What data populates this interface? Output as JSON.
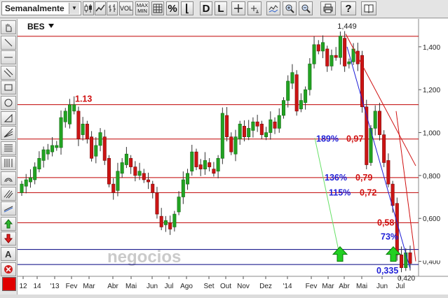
{
  "toolbar": {
    "period_label": "Semanalmente",
    "buttons": [
      {
        "name": "toolbar-candles-button",
        "icon": "candlestick-icon",
        "label": ""
      },
      {
        "name": "toolbar-line-type-button",
        "icon": "line-chart-icon",
        "label": ""
      },
      {
        "name": "toolbar-bars-button",
        "icon": "ohlc-bars-icon",
        "label": ""
      },
      {
        "name": "toolbar-volume-button",
        "icon": "",
        "label": "VOL"
      },
      {
        "name": "toolbar-maxmin-button",
        "icon": "",
        "label": "MAX MIN"
      },
      {
        "name": "toolbar-grid-button",
        "icon": "grid-icon",
        "label": ""
      },
      {
        "name": "toolbar-percent-button",
        "icon": "",
        "label": "%"
      },
      {
        "name": "toolbar-log-button",
        "icon": "",
        "label": "⌊"
      },
      {
        "name": "toolbar-daily-button",
        "icon": "",
        "label": "D"
      },
      {
        "name": "toolbar-linear-button",
        "icon": "",
        "label": "L"
      },
      {
        "name": "toolbar-crosshair-button",
        "icon": "crosshair-icon",
        "label": ""
      },
      {
        "name": "toolbar-cursor-button",
        "icon": "cursor-icon",
        "label": ""
      },
      {
        "name": "toolbar-indicator-button",
        "icon": "indicator-icon",
        "label": ""
      },
      {
        "name": "toolbar-zoom-in-button",
        "icon": "zoom-in-icon",
        "label": ""
      },
      {
        "name": "toolbar-zoom-out-button",
        "icon": "zoom-out-icon",
        "label": ""
      },
      {
        "name": "toolbar-print-button",
        "icon": "print-icon",
        "label": ""
      },
      {
        "name": "toolbar-help-button",
        "icon": "",
        "label": "?"
      },
      {
        "name": "toolbar-book-button",
        "icon": "book-icon",
        "label": ""
      }
    ]
  },
  "sidebar": {
    "tools": [
      {
        "name": "hand-tool",
        "icon": "hand-icon"
      },
      {
        "name": "line-tool",
        "icon": "diagonal-line-icon"
      },
      {
        "name": "hline-tool",
        "icon": "horizontal-line-icon"
      },
      {
        "name": "channel-tool",
        "icon": "parallel-channel-icon"
      },
      {
        "name": "rectangle-tool",
        "icon": "rectangle-icon"
      },
      {
        "name": "circle-tool",
        "icon": "circle-icon"
      },
      {
        "name": "triangle-tool",
        "icon": "triangle-icon"
      },
      {
        "name": "fan-tool",
        "icon": "fan-lines-icon"
      },
      {
        "name": "fibonacci-tool",
        "icon": "fibonacci-icon"
      },
      {
        "name": "fibonacci-time-tool",
        "icon": "vertical-lines-icon"
      },
      {
        "name": "arc-tool",
        "icon": "arc-icon"
      },
      {
        "name": "pitchfork-tool",
        "icon": "pitchfork-icon"
      },
      {
        "name": "regression-tool",
        "icon": "regression-icon"
      },
      {
        "name": "buy-arrow-tool",
        "icon": "up-arrow-icon"
      },
      {
        "name": "sell-arrow-tool",
        "icon": "down-arrow-icon"
      },
      {
        "name": "text-tool",
        "icon": "text-icon"
      },
      {
        "name": "delete-tool",
        "icon": "delete-icon"
      }
    ],
    "color_swatch": "#e00000"
  },
  "chart_data": {
    "type": "candlestick",
    "symbol": "BES",
    "watermark": "negocios",
    "x_tick_labels": [
      "12",
      "14",
      "'13",
      "Fev",
      "Mar",
      "Abr",
      "Mai",
      "Jun",
      "Jul",
      "Ago",
      "Set",
      "Out",
      "Nov",
      "Dez",
      "'14",
      "Fev",
      "Mar",
      "Abr",
      "Mai",
      "Jun",
      "Jul"
    ],
    "y_tick_labels": [
      "0,400",
      "0,600",
      "0,800",
      "1,000",
      "1,200",
      "1,400"
    ],
    "y_range": [
      0.33,
      1.53
    ],
    "candles": [
      [
        0.72,
        0.76
      ],
      [
        0.75,
        0.78
      ],
      [
        0.77,
        0.79
      ],
      [
        0.78,
        0.84
      ],
      [
        0.83,
        0.88
      ],
      [
        0.87,
        0.92
      ],
      [
        0.9,
        0.92
      ],
      [
        0.91,
        0.94
      ],
      [
        0.93,
        0.94
      ],
      [
        0.93,
        1.07
      ],
      [
        1.05,
        1.1
      ],
      [
        1.04,
        1.13
      ],
      [
        1.1,
        1.13
      ],
      [
        1.1,
        0.97
      ],
      [
        0.99,
        1.04
      ],
      [
        1.04,
        0.97
      ],
      [
        0.98,
        0.88
      ],
      [
        0.89,
        0.94
      ],
      [
        0.94,
        1.0
      ],
      [
        0.98,
        0.87
      ],
      [
        0.88,
        0.76
      ],
      [
        0.76,
        0.72
      ],
      [
        0.73,
        0.82
      ],
      [
        0.81,
        0.86
      ],
      [
        0.85,
        0.9
      ],
      [
        0.88,
        0.84
      ],
      [
        0.84,
        0.8
      ],
      [
        0.8,
        0.82
      ],
      [
        0.81,
        0.78
      ],
      [
        0.78,
        0.77
      ],
      [
        0.76,
        0.72
      ],
      [
        0.72,
        0.62
      ],
      [
        0.61,
        0.56
      ],
      [
        0.57,
        0.59
      ],
      [
        0.58,
        0.55
      ],
      [
        0.56,
        0.62
      ],
      [
        0.63,
        0.7
      ],
      [
        0.7,
        0.78
      ],
      [
        0.76,
        0.81
      ],
      [
        0.82,
        0.91
      ],
      [
        0.91,
        0.84
      ],
      [
        0.85,
        0.83
      ],
      [
        0.83,
        0.87
      ],
      [
        0.86,
        0.84
      ],
      [
        0.83,
        0.81
      ],
      [
        0.82,
        0.88
      ],
      [
        0.88,
        1.09
      ],
      [
        1.08,
        0.98
      ],
      [
        0.98,
        0.91
      ],
      [
        0.9,
        0.98
      ],
      [
        0.97,
        1.04
      ],
      [
        1.03,
        0.98
      ],
      [
        0.98,
        1.02
      ],
      [
        1.01,
        1.05
      ],
      [
        1.05,
        1.03
      ],
      [
        1.04,
        0.99
      ],
      [
        0.98,
        1.0
      ],
      [
        1.0,
        1.06
      ],
      [
        1.05,
        1.02
      ],
      [
        1.02,
        1.08
      ],
      [
        1.08,
        1.15
      ],
      [
        1.15,
        1.24
      ],
      [
        1.23,
        1.28
      ],
      [
        1.27,
        1.1
      ],
      [
        1.11,
        1.15
      ],
      [
        1.14,
        1.2
      ],
      [
        1.2,
        1.32
      ],
      [
        1.32,
        1.41
      ],
      [
        1.41,
        1.38
      ],
      [
        1.38,
        1.42
      ],
      [
        1.39,
        1.31
      ],
      [
        1.31,
        1.36
      ],
      [
        1.36,
        1.35
      ],
      [
        1.35,
        1.45
      ],
      [
        1.44,
        1.31
      ],
      [
        1.32,
        1.33
      ],
      [
        1.33,
        1.39
      ],
      [
        1.38,
        1.32
      ],
      [
        1.36,
        1.12
      ],
      [
        1.12,
        0.85
      ],
      [
        0.86,
        1.02
      ],
      [
        1.02,
        1.1
      ],
      [
        1.1,
        0.99
      ],
      [
        0.99,
        0.86
      ],
      [
        0.87,
        0.76
      ],
      [
        0.76,
        0.66
      ],
      [
        0.67,
        0.43
      ],
      [
        0.43,
        0.37
      ],
      [
        0.37,
        0.44
      ],
      [
        0.44,
        0.39
      ]
    ],
    "horizontal_levels": [
      {
        "value": 1.449,
        "label": "1,449",
        "color": "#c00000"
      },
      {
        "value": 1.13,
        "label": "1.13",
        "color": "#c00000"
      },
      {
        "value": 0.97,
        "label": "0,97",
        "color": "#c00000",
        "pct": "189%"
      },
      {
        "value": 0.79,
        "label": "0,79",
        "color": "#c00000",
        "pct": "136%"
      },
      {
        "value": 0.72,
        "label": "0,72",
        "color": "#c00000",
        "pct": "115%"
      },
      {
        "value": 0.58,
        "label": "0,58",
        "color": "#c00000"
      },
      {
        "value": 0.455,
        "label": "",
        "color": "#000080",
        "pct": "73%"
      },
      {
        "value": 0.385,
        "label": "0,335",
        "color": "#000080"
      }
    ],
    "low_label": "0,420",
    "current_price": 0.42
  }
}
